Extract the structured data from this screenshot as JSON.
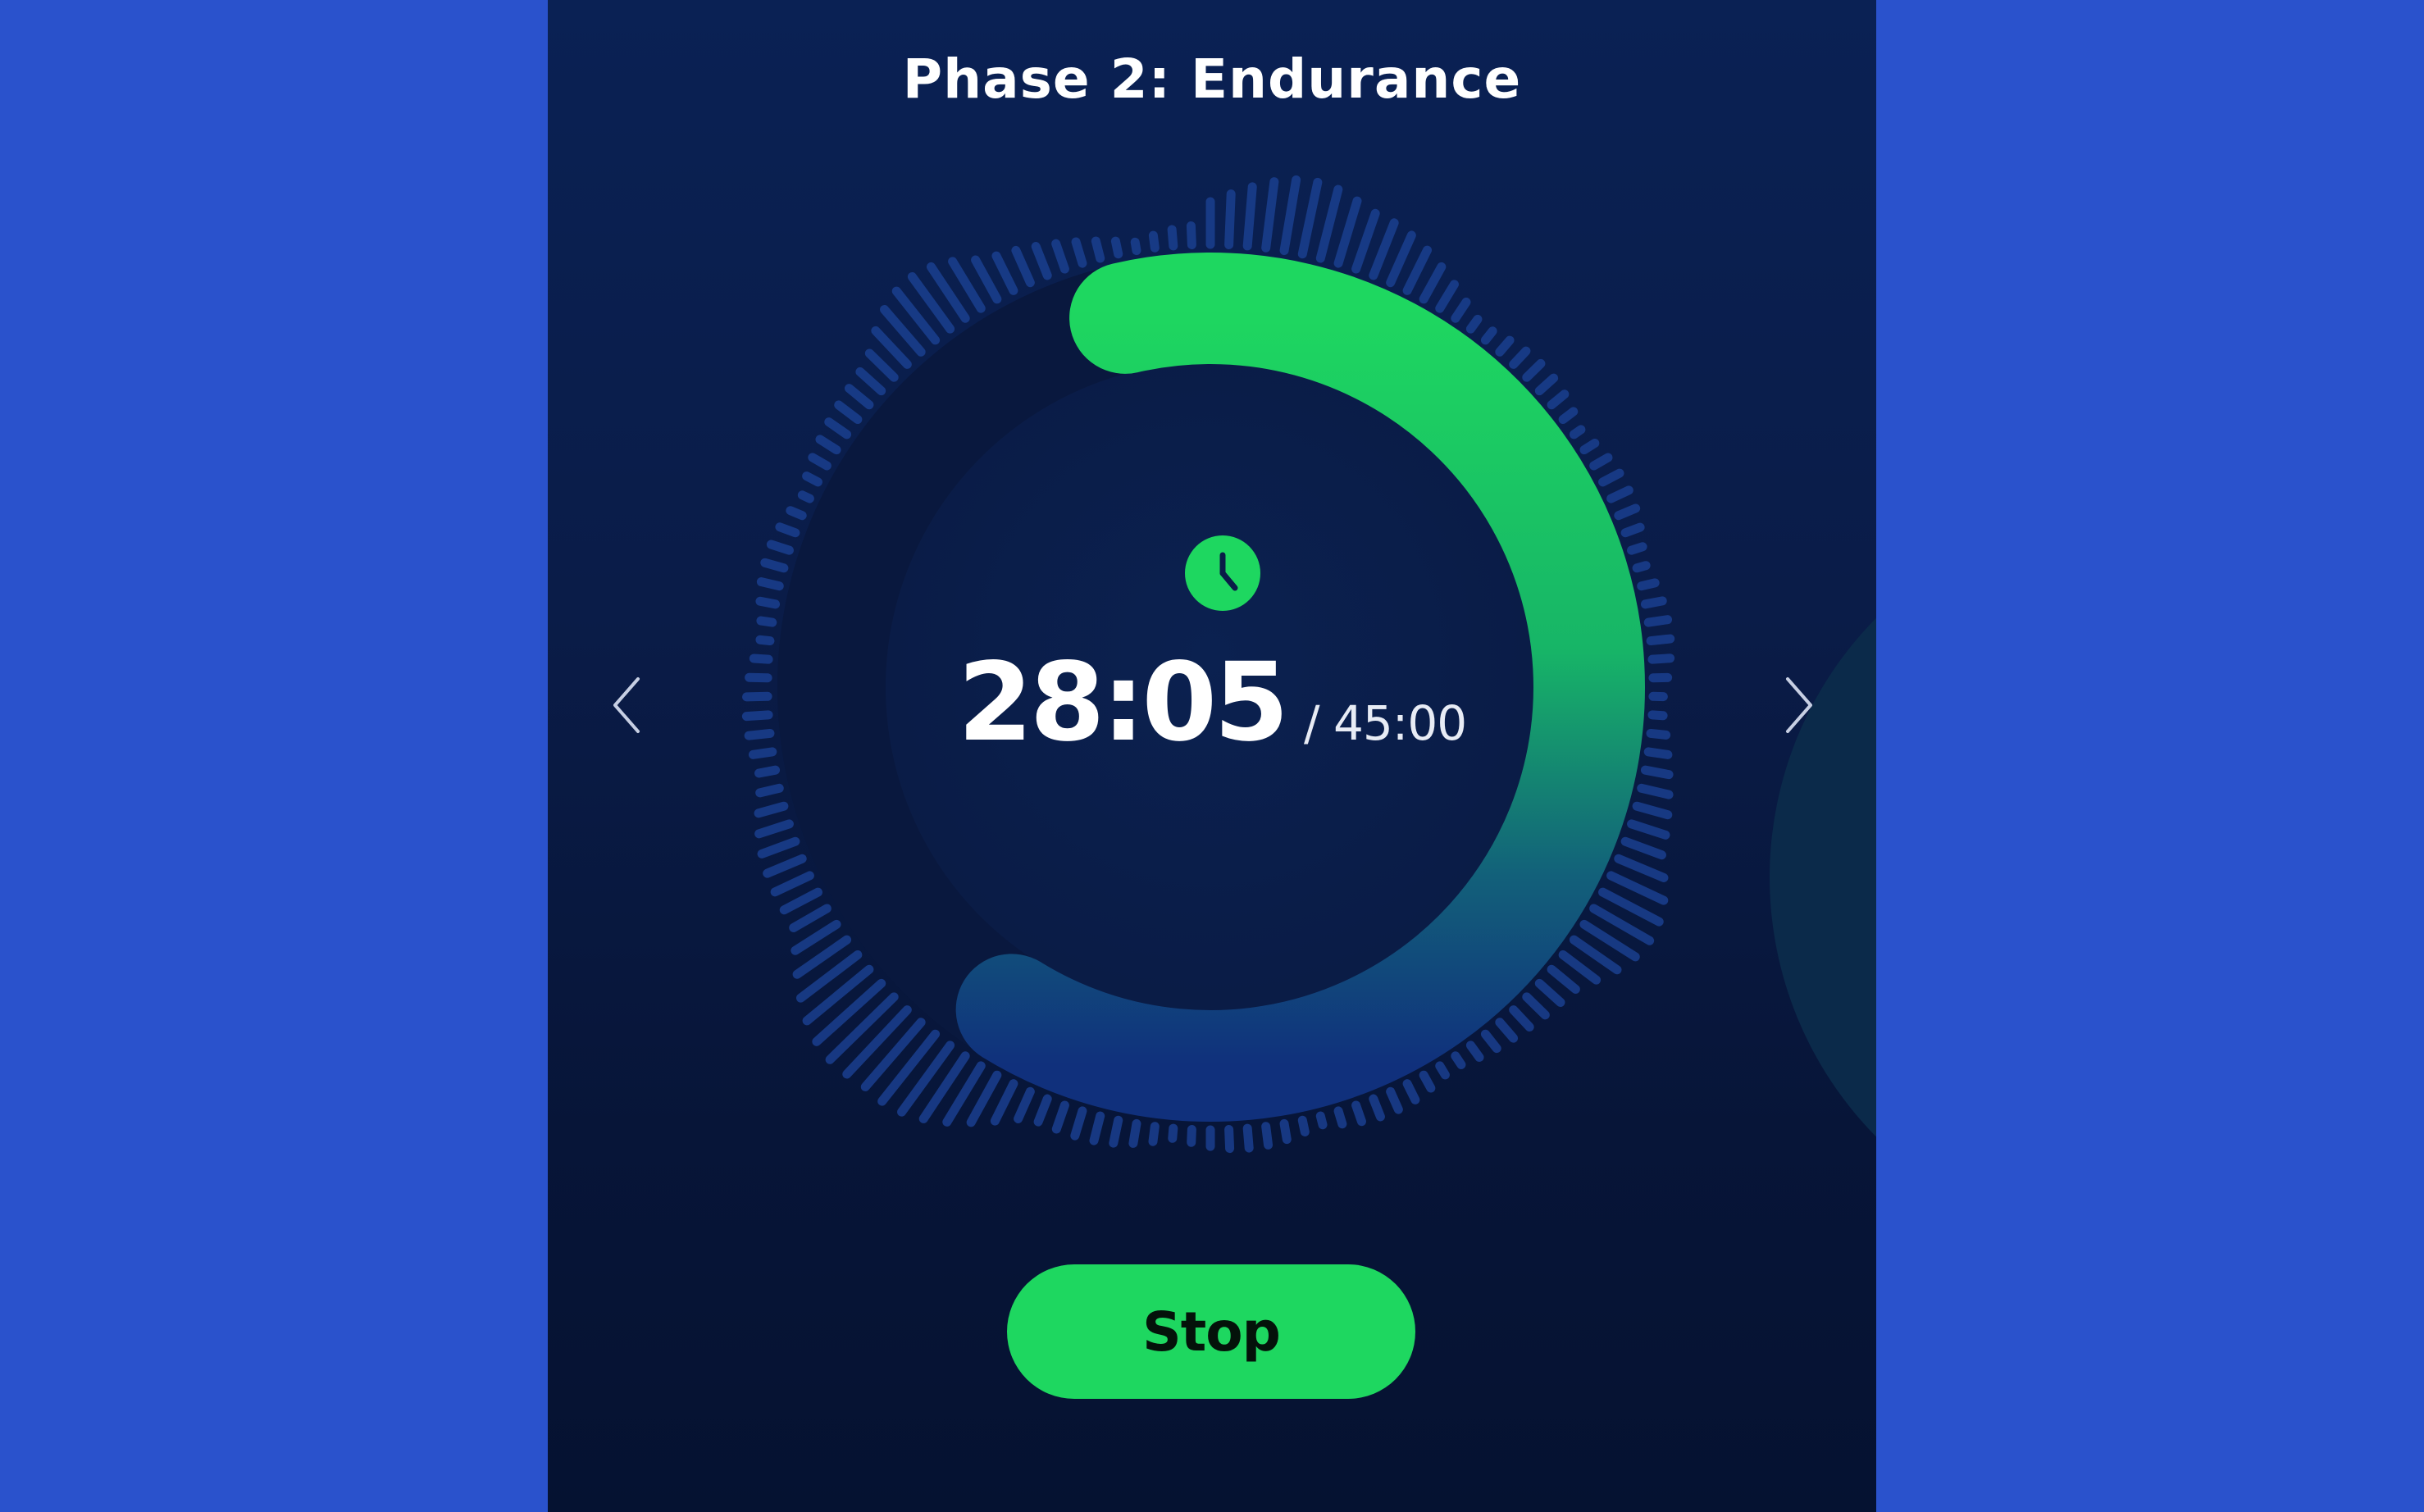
{
  "screen": {
    "phase_title": "Phase 2: Endurance"
  },
  "timer": {
    "elapsed": "28:05",
    "total": "/ 45:00",
    "progress_fraction": 0.624,
    "icon": "clock-icon"
  },
  "navigation": {
    "previous_icon": "chevron-left-icon",
    "next_icon": "chevron-right-icon"
  },
  "actions": {
    "stop_label": "Stop"
  },
  "colors": {
    "page_background": "#2a52cc",
    "panel_background": "#0a1c48",
    "accent_green": "#1ed760",
    "progress_end_blue": "#12337a",
    "visualizer_blue": "#1a3f8f"
  }
}
